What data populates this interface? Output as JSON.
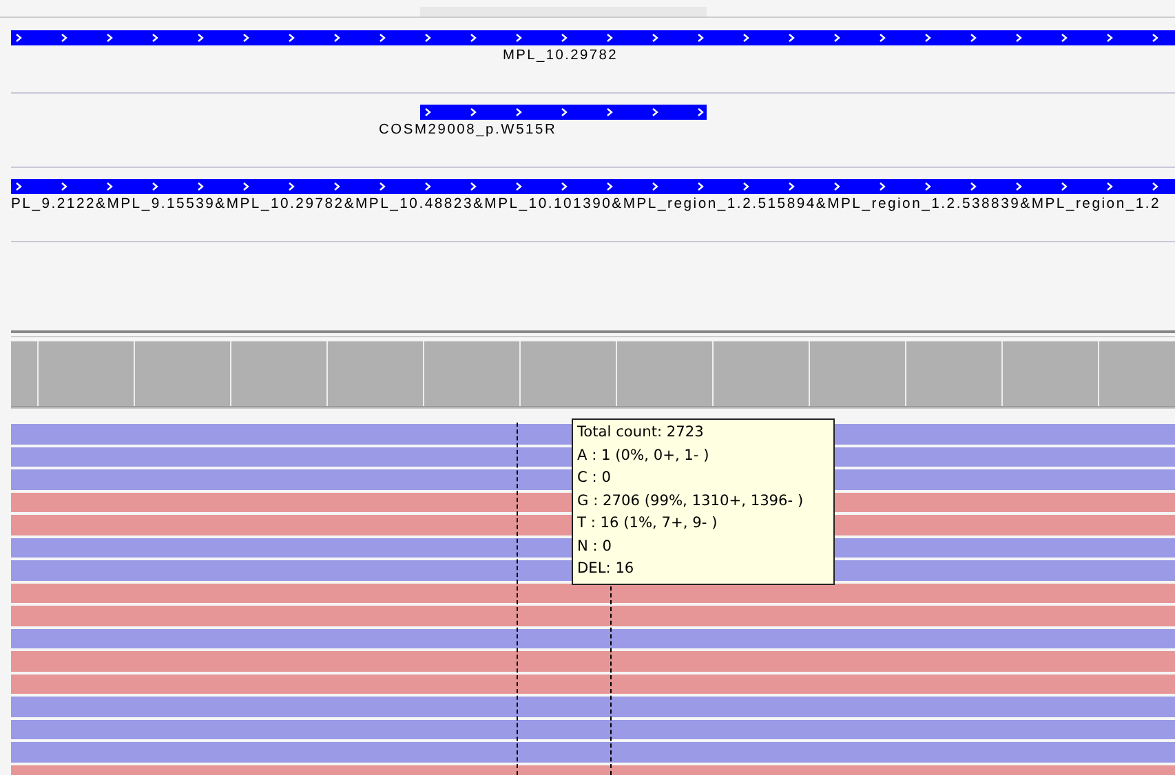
{
  "feature_tracks": [
    {
      "kind": "full",
      "label": "MPL_10.29782"
    },
    {
      "kind": "partial",
      "label": "COSM29008_p.W515R"
    },
    {
      "kind": "full_left_label",
      "label": "PL_9.2122&MPL_9.15539&MPL_10.29782&MPL_10.48823&MPL_10.101390&MPL_region_1.2.515894&MPL_region_1.2.538839&MPL_region_1.2"
    }
  ],
  "reads": [
    {
      "color": "#9a9ae6"
    },
    {
      "color": "#9a9ae6"
    },
    {
      "color": "#9a9ae6"
    },
    {
      "color": "#e69696"
    },
    {
      "color": "#e69696"
    },
    {
      "color": "#9a9ae6"
    },
    {
      "color": "#9a9ae6"
    },
    {
      "color": "#e69696"
    },
    {
      "color": "#e69696"
    },
    {
      "color": "#9a9ae6"
    },
    {
      "color": "#e69696"
    },
    {
      "color": "#e69696"
    },
    {
      "color": "#9a9ae6"
    },
    {
      "color": "#9a9ae6"
    },
    {
      "color": "#9a9ae6"
    },
    {
      "color": "#e69696"
    }
  ],
  "tooltip": {
    "lines": [
      "Total count: 2723",
      "A : 1 (0%, 0+, 1- )",
      "C : 0",
      "G : 2706 (99%, 1310+, 1396- )",
      "T : 16 (1%, 7+, 9- )",
      "N : 0",
      "DEL: 16"
    ]
  }
}
